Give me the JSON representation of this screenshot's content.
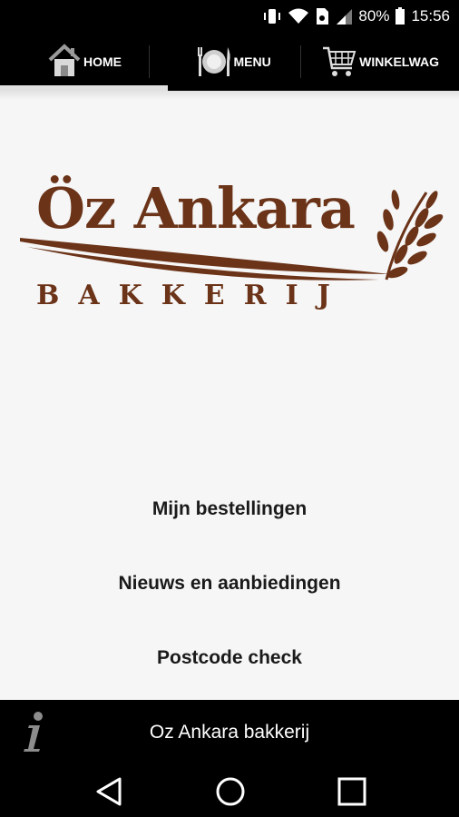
{
  "status_bar": {
    "battery_percent": "80%",
    "time": "15:56",
    "icons": [
      "vibrate-icon",
      "wifi-icon",
      "sim-icon",
      "signal-icon",
      "battery-icon"
    ]
  },
  "tabs": [
    {
      "label": "HOME",
      "icon": "home-icon",
      "active": true
    },
    {
      "label": "MENU",
      "icon": "plate-cutlery-icon",
      "active": false
    },
    {
      "label": "WINKELWAG",
      "icon": "shopping-cart-icon",
      "active": false
    }
  ],
  "logo": {
    "title": "Öz Ankara",
    "subtitle": "BAKKERIJ",
    "color": "#6b3318"
  },
  "menu_links": [
    {
      "label": "Mijn bestellingen"
    },
    {
      "label": "Nieuws en aanbiedingen"
    },
    {
      "label": "Postcode check"
    }
  ],
  "footer": {
    "title": "Oz Ankara bakkerij",
    "icon": "info-icon"
  },
  "nav_bar": {
    "icons": [
      "back-icon",
      "home-circle-icon",
      "recent-apps-icon"
    ]
  }
}
